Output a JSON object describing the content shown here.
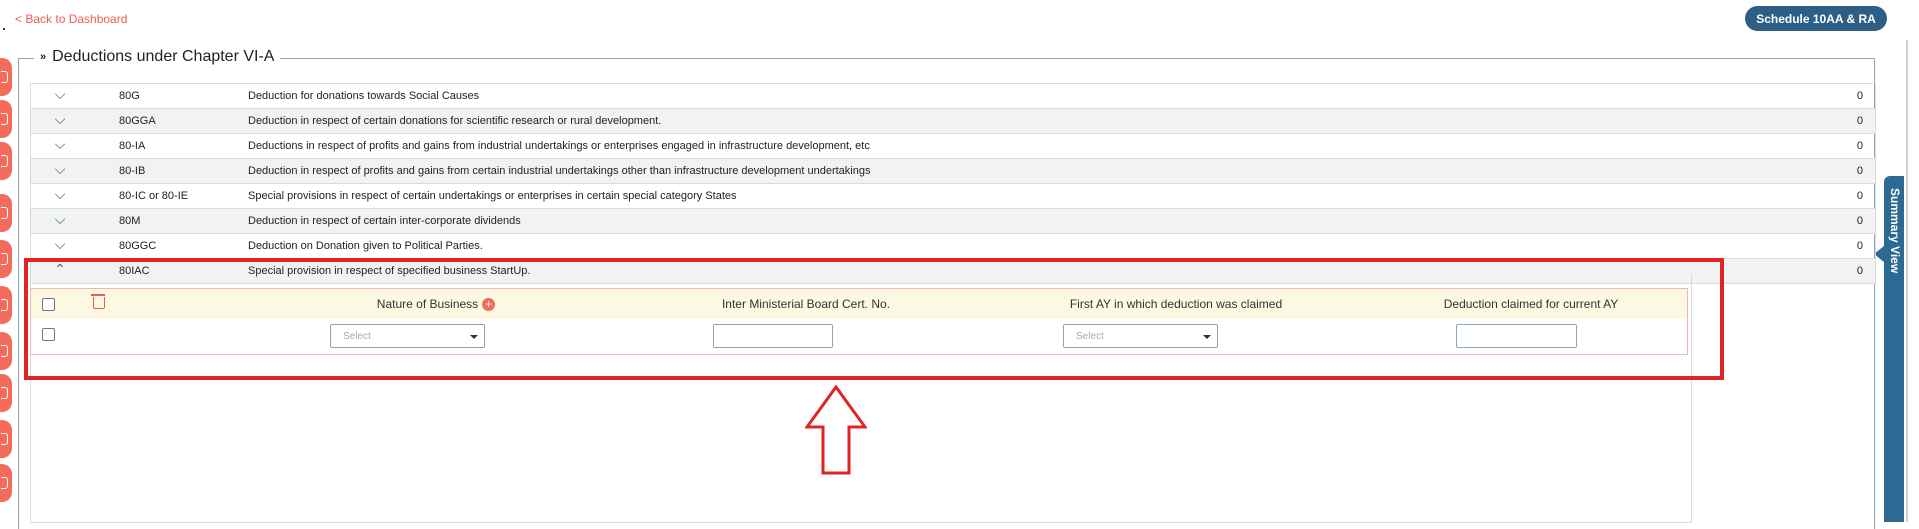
{
  "header": {
    "back_label": "< Back to Dashboard",
    "schedule_button": "Schedule 10AA & RA"
  },
  "section": {
    "title": "Deductions under Chapter VI-A"
  },
  "side_tab": {
    "label": "Summary View"
  },
  "rows": [
    {
      "code": "80G",
      "desc": "Deduction for donations towards Social Causes",
      "amount": "0"
    },
    {
      "code": "80GGA",
      "desc": "Deduction in respect of certain donations for scientific research or rural development.",
      "amount": "0"
    },
    {
      "code": "80-IA",
      "desc": "Deductions in respect of profits and gains from industrial undertakings or enterprises engaged in infrastructure development, etc",
      "amount": "0"
    },
    {
      "code": "80-IB",
      "desc": "Deduction in respect of profits and gains from certain industrial undertakings other than infrastructure development undertakings",
      "amount": "0"
    },
    {
      "code": "80-IC or 80-IE",
      "desc": "Special provisions in respect of certain undertakings or enterprises in certain special category States",
      "amount": "0"
    },
    {
      "code": "80M",
      "desc": "Deduction in respect of certain inter-corporate dividends",
      "amount": "0"
    },
    {
      "code": "80GGC",
      "desc": "Deduction on Donation given to Political Parties.",
      "amount": "0"
    },
    {
      "code": "80IAC",
      "desc": "Special provision in respect of specified business StartUp.",
      "amount": "0"
    }
  ],
  "subtable": {
    "headers": [
      "Nature of Business",
      "Inter Ministerial Board Cert. No.",
      "First AY in which deduction was claimed",
      "Deduction claimed for current AY"
    ],
    "nature_placeholder": "Select",
    "first_ay_placeholder": "Select"
  },
  "colors": {
    "accent": "#f26b5b",
    "primary": "#2d5f86",
    "highlight": "#e02424"
  }
}
